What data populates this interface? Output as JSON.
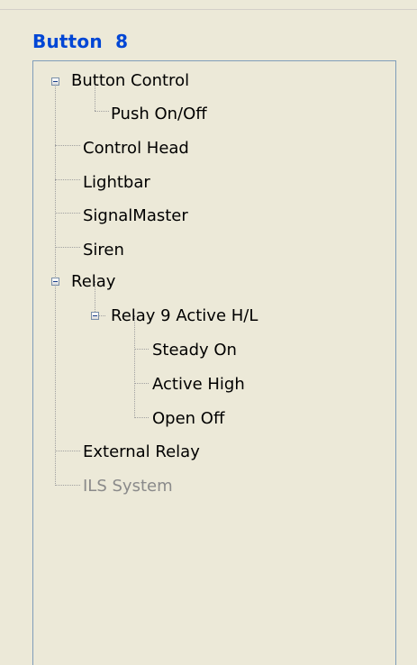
{
  "group": {
    "title": "Button  8"
  },
  "tree": {
    "button_control": "Button Control",
    "push_on_off": "Push On/Off",
    "control_head": "Control Head",
    "lightbar": "Lightbar",
    "signalmaster": "SignalMaster",
    "siren": "Siren",
    "relay": "Relay",
    "relay9": "Relay 9 Active H/L",
    "steady_on": "Steady On",
    "active_high": "Active High",
    "open_off": "Open Off",
    "external_relay": "External Relay",
    "ils_system": "ILS System"
  },
  "colors": {
    "title": "#0046d5",
    "panel_border": "#7f9db9",
    "background": "#ece9d8",
    "disabled_text": "#8a8a8a"
  },
  "icons": {
    "expanded": "minus-box-icon"
  }
}
